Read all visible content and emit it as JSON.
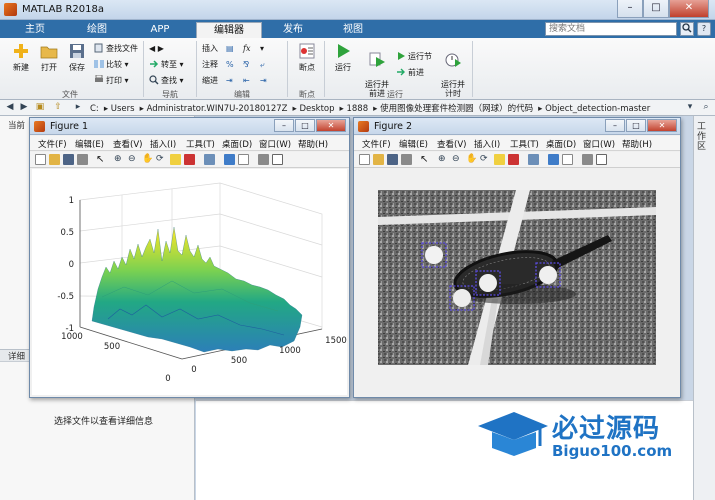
{
  "window": {
    "title": "MATLAB R2018a",
    "minimize": "–",
    "maximize": "□",
    "close": "✕"
  },
  "tabs": [
    "主页",
    "绘图",
    "APP",
    "编辑器",
    "发布",
    "视图"
  ],
  "active_tab": "编辑器",
  "search": {
    "placeholder": "搜索文档",
    "icon": "search-icon",
    "help": "?"
  },
  "ribbon": {
    "file": {
      "new": "新建",
      "open": "打开",
      "save": "保存",
      "find_files": "查找文件",
      "compare": "比较",
      "print": "打印",
      "group": "文件"
    },
    "navigate": {
      "goto": "转至",
      "find": "查找",
      "group": "导航"
    },
    "edit": {
      "insert": "插入",
      "comment": "注释",
      "indent": "缩进",
      "fx": "fx",
      "pct": "%",
      "group": "编辑"
    },
    "breakpoints": {
      "label": "断点",
      "group": "断点"
    },
    "run": {
      "run": "运行",
      "run_advance": "运行并\n前进",
      "run_section": "运行节",
      "advance": "前进",
      "run_time": "运行并\n计时",
      "group": "运行"
    }
  },
  "address": {
    "segments": [
      "C:",
      "Users",
      "Administrator.WIN7U-20180127Z",
      "Desktop",
      "1888",
      "使用图像处理套件检测圆（网球）的代码",
      "Object_detection-master"
    ]
  },
  "panels": {
    "current_folder": "当前",
    "details": "详细",
    "details_hint": "选择文件以查看详细信息",
    "workspace": "工作区"
  },
  "figure_menu": [
    "文件(F)",
    "编辑(E)",
    "查看(V)",
    "插入(I)",
    "工具(T)",
    "桌面(D)",
    "窗口(W)",
    "帮助(H)"
  ],
  "figure1": {
    "title": "Figure 1",
    "chart_data": {
      "type": "area",
      "title": "",
      "z_ticks": [
        "1",
        "0.5",
        "0",
        "-0.5",
        "-1"
      ],
      "x_ticks": [
        "0",
        "500",
        "1000",
        "1500"
      ],
      "y_ticks": [
        "0",
        "500",
        "1000"
      ],
      "zlim": [
        -1,
        1
      ],
      "grid": true
    }
  },
  "figure2": {
    "title": "Figure 2",
    "detected_circles": 4
  },
  "watermark": {
    "text": "必过源码",
    "url": "Biguo100.com"
  },
  "colors": {
    "matlab_blue": "#2f6ea8",
    "surface_low": "#2c7fb8",
    "surface_high": "#fde725",
    "detect_box": "#5b4ce0"
  }
}
